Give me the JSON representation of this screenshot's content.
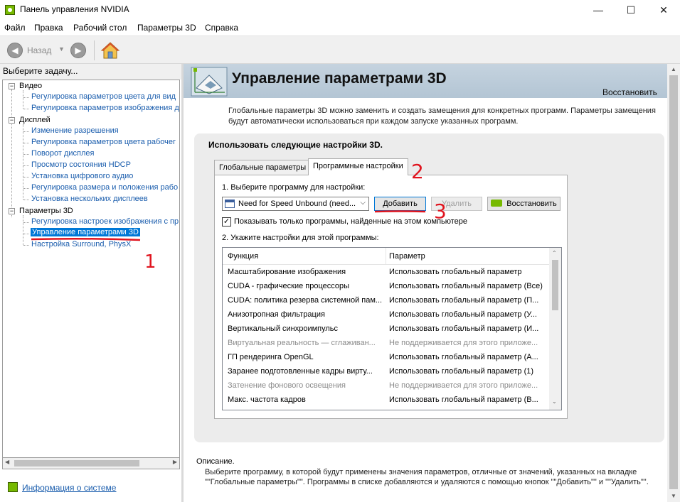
{
  "window": {
    "title": "Панель управления NVIDIA",
    "minimize": "—",
    "maximize": "☐",
    "close": "✕"
  },
  "menu": [
    "Файл",
    "Правка",
    "Рабочий стол",
    "Параметры 3D",
    "Справка"
  ],
  "toolbar": {
    "back_label": "Назад",
    "back_icon": "arrow-left-icon",
    "forward_icon": "arrow-right-icon",
    "home_icon": "home-icon"
  },
  "left_panel": {
    "header": "Выберите задачу...",
    "tree": [
      {
        "label": "Видео",
        "type": "category"
      },
      {
        "label": "Регулировка параметров цвета для вид",
        "type": "link"
      },
      {
        "label": "Регулировка параметров изображения д",
        "type": "link"
      },
      {
        "label": "Дисплей",
        "type": "category"
      },
      {
        "label": "Изменение разрешения",
        "type": "link"
      },
      {
        "label": "Регулировка параметров цвета рабочег",
        "type": "link"
      },
      {
        "label": "Поворот дисплея",
        "type": "link"
      },
      {
        "label": "Просмотр состояния HDCP",
        "type": "link"
      },
      {
        "label": "Установка цифрового аудио",
        "type": "link"
      },
      {
        "label": "Регулировка размера и положения рабо",
        "type": "link"
      },
      {
        "label": "Установка нескольких дисплеев",
        "type": "link"
      },
      {
        "label": "Параметры 3D",
        "type": "category"
      },
      {
        "label": "Регулировка настроек изображения с пр",
        "type": "link"
      },
      {
        "label": "Управление параметрами 3D",
        "type": "selected"
      },
      {
        "label": "Настройка Surround, PhysX",
        "type": "link"
      }
    ],
    "sysinfo": "Информация о системе"
  },
  "main": {
    "title": "Управление параметрами 3D",
    "restore_label": "Восстановить",
    "intro": "Глобальные параметры 3D можно заменить и создать замещения для конкретных программ. Параметры замещения будут автоматически использоваться при каждом запуске указанных программ.",
    "section_title": "Использовать следующие настройки 3D.",
    "tabs": [
      "Глобальные параметры",
      "Программные настройки"
    ],
    "step1": "1. Выберите программу для настройки:",
    "program_selected": "Need for Speed Unbound (need...",
    "add_button": "Добавить",
    "remove_button": "Удалить",
    "restore_button": "Восстановить",
    "checkbox_label": "Показывать только программы, найденные на этом компьютере",
    "checkbox_checked": true,
    "step2": "2. Укажите настройки для этой программы:",
    "grid": {
      "headers": [
        "Функция",
        "Параметр"
      ],
      "rows": [
        {
          "f": "Масштабирование изображения",
          "p": "Использовать глобальный параметр",
          "dim": false
        },
        {
          "f": "CUDA - графические процессоры",
          "p": "Использовать глобальный параметр (Все)",
          "dim": false
        },
        {
          "f": "CUDA: политика резерва системной пам...",
          "p": "Использовать глобальный параметр (П...",
          "dim": false
        },
        {
          "f": "Анизотропная фильтрация",
          "p": "Использовать глобальный параметр (У...",
          "dim": false
        },
        {
          "f": "Вертикальный синхроимпульс",
          "p": "Использовать глобальный параметр (И...",
          "dim": false
        },
        {
          "f": "Виртуальная реальность — сглаживан...",
          "p": "Не поддерживается для этого приложе...",
          "dim": true
        },
        {
          "f": "ГП рендеринга OpenGL",
          "p": "Использовать глобальный параметр (А...",
          "dim": false
        },
        {
          "f": "Заранее подготовленные кадры вирту...",
          "p": "Использовать глобальный параметр (1)",
          "dim": false
        },
        {
          "f": "Затенение фонового освещения",
          "p": "Не поддерживается для этого приложе...",
          "dim": true
        },
        {
          "f": "Макс. частота кадров",
          "p": "Использовать глобальный параметр (В...",
          "dim": false
        }
      ]
    },
    "desc_title": "Описание.",
    "desc_text": "Выберите программу, в которой будут применены значения параметров, отличные от значений, указанных на вкладке \"\"Глобальные параметры\"\". Программы в списке добавляются и удаляются с помощью кнопок \"\"Добавить\"\" и \"\"Удалить\"\"."
  },
  "annotations": [
    "1",
    "2",
    "3"
  ],
  "colors": {
    "nvidia_green": "#76b900",
    "link_blue": "#1a5dad",
    "selection_blue": "#0078d7",
    "annotation_red": "#e0141e"
  }
}
